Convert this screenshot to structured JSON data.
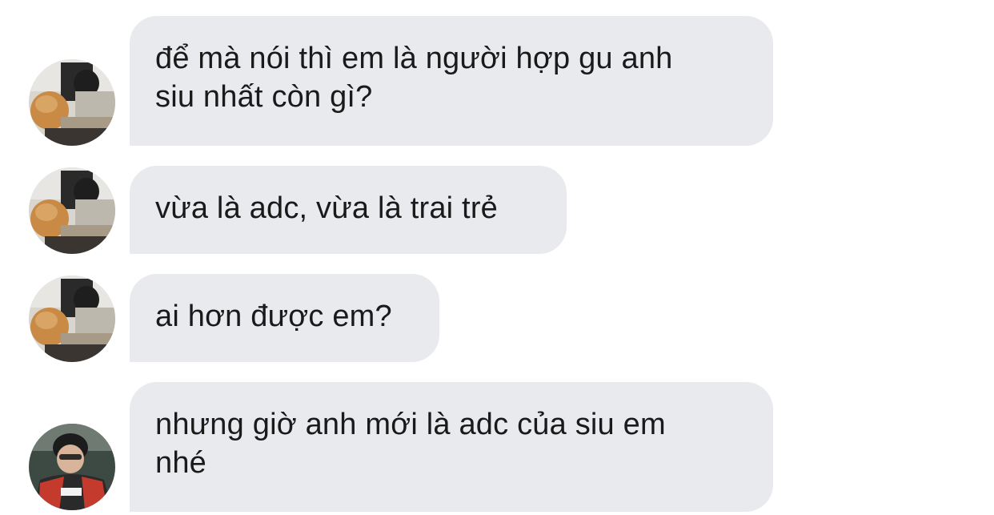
{
  "messages": [
    {
      "avatar": "sender-avatar-cat-photo-icon",
      "lines": [
        "để mà nói thì em là người hợp gu anh",
        "siu nhất còn gì?"
      ]
    },
    {
      "avatar": "sender-avatar-cat-photo-icon",
      "lines": [
        "vừa là adc, vừa là trai trẻ"
      ]
    },
    {
      "avatar": "sender-avatar-cat-photo-icon",
      "lines": [
        "ai hơn được em?"
      ]
    },
    {
      "avatar": "sender-avatar-gamer-photo-icon",
      "lines": [
        "nhưng giờ anh mới là adc của siu em",
        "nhé"
      ]
    }
  ],
  "colors": {
    "bubble": "#e9eaee",
    "text": "#1a1a1a",
    "background": "#ffffff"
  }
}
